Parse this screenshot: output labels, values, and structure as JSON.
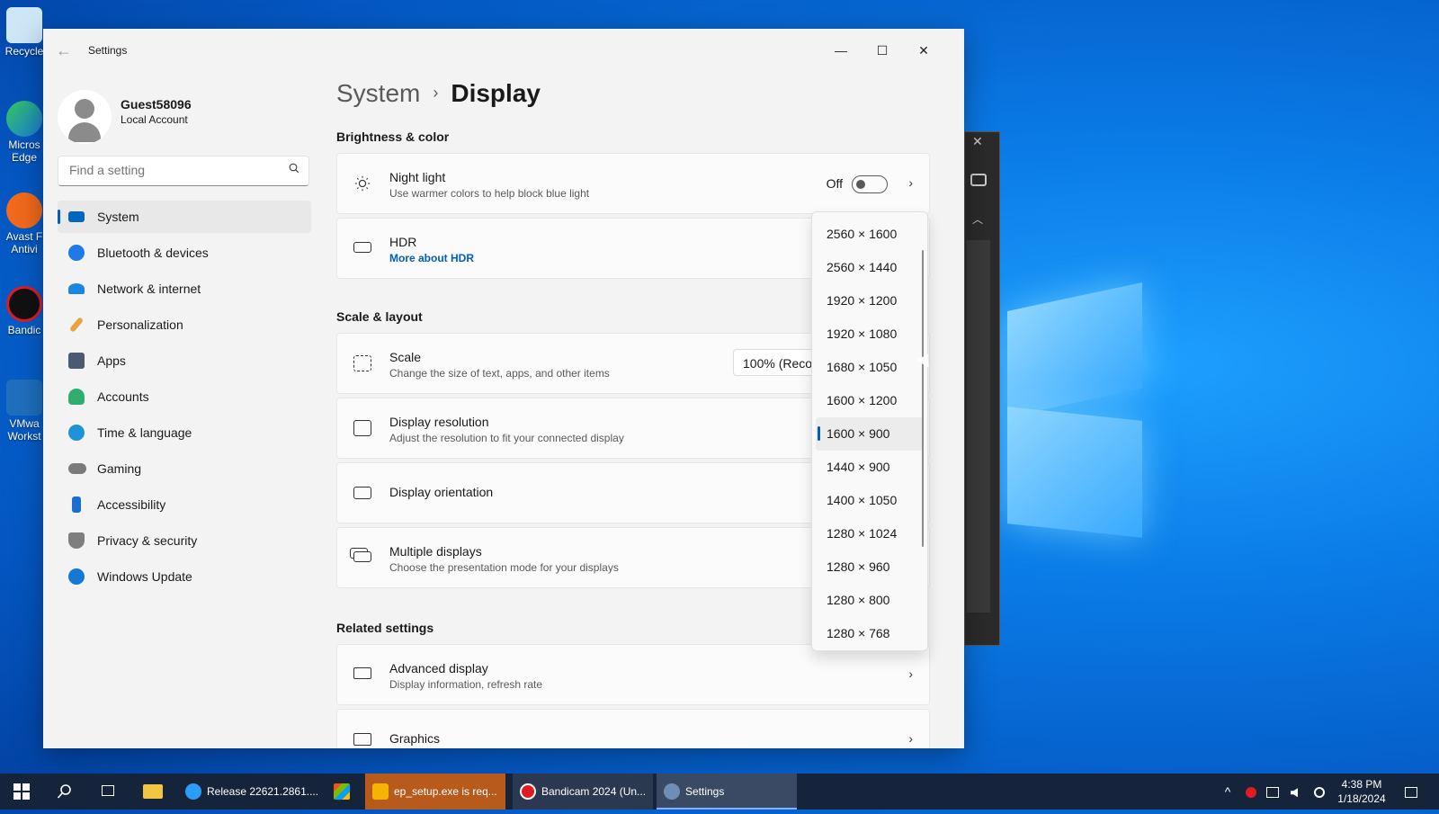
{
  "desktop": {
    "icons": [
      {
        "label": "Recycle"
      },
      {
        "label": "Micros\nEdge"
      },
      {
        "label": "Avast F\nAntivi"
      },
      {
        "label": "Bandic"
      },
      {
        "label": "VMwa\nWorkst"
      }
    ]
  },
  "window": {
    "title": "Settings",
    "minimize": "—",
    "maximize": "☐",
    "close": "✕"
  },
  "profile": {
    "name": "Guest58096",
    "account_type": "Local Account"
  },
  "search": {
    "placeholder": "Find a setting"
  },
  "nav": {
    "items": [
      {
        "label": "System",
        "color": "#0067c0"
      },
      {
        "label": "Bluetooth & devices",
        "color": "#1e7ae6"
      },
      {
        "label": "Network & internet",
        "color": "#1b86e0"
      },
      {
        "label": "Personalization",
        "color": "#e8a33c"
      },
      {
        "label": "Apps",
        "color": "#4a5a70"
      },
      {
        "label": "Accounts",
        "color": "#2fae6e"
      },
      {
        "label": "Time & language",
        "color": "#1e94d8"
      },
      {
        "label": "Gaming",
        "color": "#7a7a7a"
      },
      {
        "label": "Accessibility",
        "color": "#1a6ed1"
      },
      {
        "label": "Privacy & security",
        "color": "#7e7e7e"
      },
      {
        "label": "Windows Update",
        "color": "#1479d6"
      }
    ]
  },
  "breadcrumb": {
    "parent": "System",
    "separator": "›",
    "current": "Display"
  },
  "sections": {
    "brightness": "Brightness & color",
    "scale_layout": "Scale & layout",
    "related": "Related settings"
  },
  "cards": {
    "night_light": {
      "title": "Night light",
      "subtitle": "Use warmer colors to help block blue light",
      "toggle_state": "Off"
    },
    "hdr": {
      "title": "HDR",
      "link": "More about HDR"
    },
    "scale": {
      "title": "Scale",
      "subtitle": "Change the size of text, apps, and other items",
      "value": "100% (Recommended)"
    },
    "resolution": {
      "title": "Display resolution",
      "subtitle": "Adjust the resolution to fit your connected display"
    },
    "orientation": {
      "title": "Display orientation"
    },
    "multiple": {
      "title": "Multiple displays",
      "subtitle": "Choose the presentation mode for your displays"
    },
    "advanced": {
      "title": "Advanced display",
      "subtitle": "Display information, refresh rate"
    },
    "graphics": {
      "title": "Graphics"
    }
  },
  "resolution_dropdown": {
    "options": [
      "2560 × 1600",
      "2560 × 1440",
      "1920 × 1200",
      "1920 × 1080",
      "1680 × 1050",
      "1600 × 1200",
      "1600 × 900",
      "1440 × 900",
      "1400 × 1050",
      "1280 × 1024",
      "1280 × 960",
      "1280 × 800",
      "1280 × 768"
    ],
    "selected": "1600 × 900"
  },
  "taskbar": {
    "apps": [
      {
        "label": "Release 22621.2861....",
        "color": "#2a9df4"
      },
      {
        "label": "ep_setup.exe is req...",
        "color": "#f5b400",
        "highlight": "#b85a1c"
      },
      {
        "label": "Bandicam 2024 (Un...",
        "color": "#e01b24"
      },
      {
        "label": "Settings",
        "color": "#6d8fb7"
      }
    ],
    "time": "4:38 PM",
    "date": "1/18/2024"
  }
}
